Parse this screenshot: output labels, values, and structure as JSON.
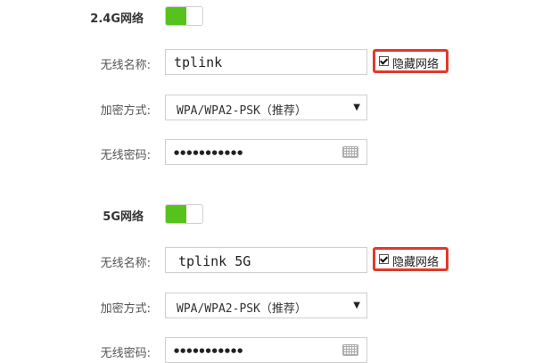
{
  "band24": {
    "title": "2.4G网络",
    "enabled": true,
    "ssid_label": "无线名称:",
    "ssid_value": "tplink",
    "hide_label": "隐藏网络",
    "hide_checked": true,
    "encryption_label": "加密方式:",
    "encryption_value": "WPA/WPA2-PSK（推荐）",
    "password_label": "无线密码:",
    "password_mask": "●●●●●●●●●●●"
  },
  "band5": {
    "title": "5G网络",
    "enabled": true,
    "ssid_label": "无线名称:",
    "ssid_value": "tplink 5G",
    "hide_label": "隐藏网络",
    "hide_checked": true,
    "encryption_label": "加密方式:",
    "encryption_value": "WPA/WPA2-PSK（推荐）",
    "password_label": "无线密码:",
    "password_mask": "●●●●●●●●●●●"
  },
  "colors": {
    "toggle_on": "#57c21d",
    "highlight_border": "#e0392b"
  },
  "icons": {
    "select_caret": "caret-down-icon",
    "keyboard": "keyboard-icon",
    "checkbox": "checkbox-checked-icon"
  }
}
